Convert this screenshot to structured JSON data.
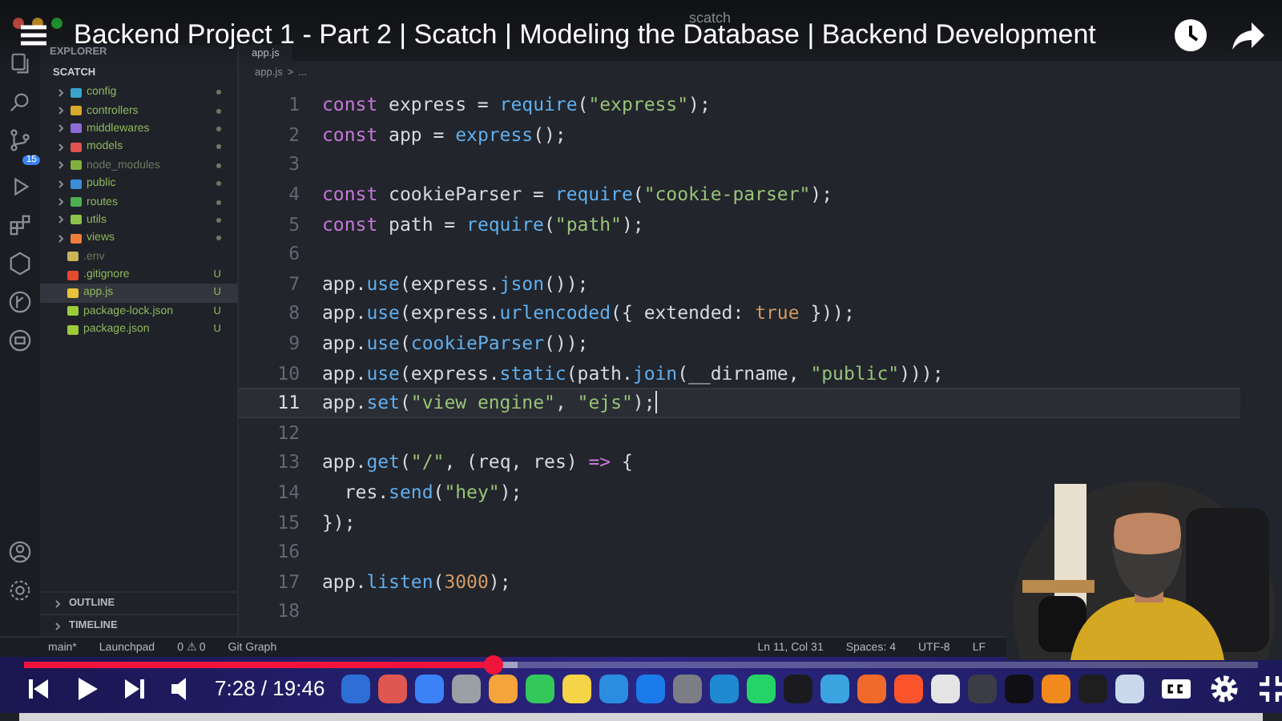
{
  "video": {
    "title": "Backend Project 1 - Part 2 | Scatch | Modeling the Database | Backend Development"
  },
  "editor_window": {
    "title": "scatch",
    "activity_badge": "15",
    "explorer": {
      "header": "EXPLORER",
      "project": "SCATCH",
      "items": [
        {
          "name": "config",
          "kind": "folder",
          "color": "#3aa3c9",
          "ignored": false,
          "selected": false,
          "changed": true
        },
        {
          "name": "controllers",
          "kind": "folder",
          "color": "#d9a92b",
          "ignored": false,
          "selected": false,
          "changed": true
        },
        {
          "name": "middlewares",
          "kind": "folder",
          "color": "#8e6cd6",
          "ignored": false,
          "selected": false,
          "changed": true
        },
        {
          "name": "models",
          "kind": "folder",
          "color": "#e0524f",
          "ignored": false,
          "selected": false,
          "changed": true
        },
        {
          "name": "node_modules",
          "kind": "folder",
          "color": "#7fb13f",
          "ignored": true,
          "selected": false,
          "changed": true
        },
        {
          "name": "public",
          "kind": "folder",
          "color": "#3a8fd6",
          "ignored": false,
          "selected": false,
          "changed": true
        },
        {
          "name": "routes",
          "kind": "folder",
          "color": "#4caf50",
          "ignored": false,
          "selected": false,
          "changed": true
        },
        {
          "name": "utils",
          "kind": "folder",
          "color": "#8bc34a",
          "ignored": false,
          "selected": false,
          "changed": true
        },
        {
          "name": "views",
          "kind": "folder",
          "color": "#f07d3c",
          "ignored": false,
          "selected": false,
          "changed": true
        },
        {
          "name": ".env",
          "kind": "file",
          "color": "#c9b458",
          "ignored": true,
          "selected": false
        },
        {
          "name": ".gitignore",
          "kind": "file",
          "color": "#e64a2e",
          "ignored": false,
          "selected": false,
          "status": "U"
        },
        {
          "name": "app.js",
          "kind": "file",
          "color": "#e8c33a",
          "ignored": false,
          "selected": true,
          "status": "U"
        },
        {
          "name": "package-lock.json",
          "kind": "file",
          "color": "#9ccc3a",
          "ignored": false,
          "selected": false,
          "status": "U"
        },
        {
          "name": "package.json",
          "kind": "file",
          "color": "#9ccc3a",
          "ignored": false,
          "selected": false,
          "status": "U"
        }
      ],
      "sections": [
        "OUTLINE",
        "TIMELINE"
      ]
    },
    "tab": "app.js",
    "breadcrumb": [
      "app.js",
      ">",
      "..."
    ],
    "code": [
      {
        "number": "1",
        "current": false,
        "tokens": [
          {
            "text": "const",
            "kind": "keyword"
          },
          {
            "text": " express = ",
            "kind": "plain"
          },
          {
            "text": "require",
            "kind": "func"
          },
          {
            "text": "(",
            "kind": "plain"
          },
          {
            "text": "\"express\"",
            "kind": "string"
          },
          {
            "text": ");",
            "kind": "plain"
          }
        ]
      },
      {
        "number": "2",
        "current": false,
        "tokens": [
          {
            "text": "const",
            "kind": "keyword"
          },
          {
            "text": " app = ",
            "kind": "plain"
          },
          {
            "text": "express",
            "kind": "func"
          },
          {
            "text": "();",
            "kind": "plain"
          }
        ]
      },
      {
        "number": "3",
        "current": false
      },
      {
        "number": "4",
        "current": false,
        "tokens": [
          {
            "text": "const",
            "kind": "keyword"
          },
          {
            "text": " cookieParser = ",
            "kind": "plain"
          },
          {
            "text": "require",
            "kind": "func"
          },
          {
            "text": "(",
            "kind": "plain"
          },
          {
            "text": "\"cookie-parser\"",
            "kind": "string"
          },
          {
            "text": ");",
            "kind": "plain"
          }
        ]
      },
      {
        "number": "5",
        "current": false,
        "tokens": [
          {
            "text": "const",
            "kind": "keyword"
          },
          {
            "text": " path = ",
            "kind": "plain"
          },
          {
            "text": "require",
            "kind": "func"
          },
          {
            "text": "(",
            "kind": "plain"
          },
          {
            "text": "\"path\"",
            "kind": "string"
          },
          {
            "text": ");",
            "kind": "plain"
          }
        ]
      },
      {
        "number": "6",
        "current": false
      },
      {
        "number": "7",
        "current": false,
        "tokens": [
          {
            "text": "app.",
            "kind": "plain"
          },
          {
            "text": "use",
            "kind": "func"
          },
          {
            "text": "(express.",
            "kind": "plain"
          },
          {
            "text": "json",
            "kind": "func"
          },
          {
            "text": "());",
            "kind": "plain"
          }
        ]
      },
      {
        "number": "8",
        "current": false,
        "tokens": [
          {
            "text": "app.",
            "kind": "plain"
          },
          {
            "text": "use",
            "kind": "func"
          },
          {
            "text": "(express.",
            "kind": "plain"
          },
          {
            "text": "urlencoded",
            "kind": "func"
          },
          {
            "text": "({ extended: ",
            "kind": "plain"
          },
          {
            "text": "true",
            "kind": "number"
          },
          {
            "text": " }));",
            "kind": "plain"
          }
        ]
      },
      {
        "number": "9",
        "current": false,
        "tokens": [
          {
            "text": "app.",
            "kind": "plain"
          },
          {
            "text": "use",
            "kind": "func"
          },
          {
            "text": "(",
            "kind": "plain"
          },
          {
            "text": "cookieParser",
            "kind": "func"
          },
          {
            "text": "());",
            "kind": "plain"
          }
        ]
      },
      {
        "number": "10",
        "current": false,
        "tokens": [
          {
            "text": "app.",
            "kind": "plain"
          },
          {
            "text": "use",
            "kind": "func"
          },
          {
            "text": "(express.",
            "kind": "plain"
          },
          {
            "text": "static",
            "kind": "func"
          },
          {
            "text": "(path.",
            "kind": "plain"
          },
          {
            "text": "join",
            "kind": "func"
          },
          {
            "text": "(__dirname, ",
            "kind": "plain"
          },
          {
            "text": "\"public\"",
            "kind": "string"
          },
          {
            "text": ")));",
            "kind": "plain"
          }
        ]
      },
      {
        "number": "11",
        "current": true,
        "tokens": [
          {
            "text": "app.",
            "kind": "plain"
          },
          {
            "text": "set",
            "kind": "func"
          },
          {
            "text": "(",
            "kind": "plain"
          },
          {
            "text": "\"view engine\"",
            "kind": "string"
          },
          {
            "text": ", ",
            "kind": "plain"
          },
          {
            "text": "\"ejs\"",
            "kind": "string"
          },
          {
            "text": ");",
            "kind": "plain"
          }
        ]
      },
      {
        "number": "12",
        "current": false
      },
      {
        "number": "13",
        "current": false,
        "tokens": [
          {
            "text": "app.",
            "kind": "plain"
          },
          {
            "text": "get",
            "kind": "func"
          },
          {
            "text": "(",
            "kind": "plain"
          },
          {
            "text": "\"/\"",
            "kind": "string"
          },
          {
            "text": ", (req, res) ",
            "kind": "plain"
          },
          {
            "text": "=>",
            "kind": "keyword"
          },
          {
            "text": " {",
            "kind": "plain"
          }
        ]
      },
      {
        "number": "14",
        "current": false,
        "tokens": [
          {
            "text": "  res.",
            "kind": "plain"
          },
          {
            "text": "send",
            "kind": "func"
          },
          {
            "text": "(",
            "kind": "plain"
          },
          {
            "text": "\"hey\"",
            "kind": "string"
          },
          {
            "text": ");",
            "kind": "plain"
          }
        ]
      },
      {
        "number": "15",
        "current": false,
        "tokens": [
          {
            "text": "});",
            "kind": "plain"
          }
        ]
      },
      {
        "number": "16",
        "current": false
      },
      {
        "number": "17",
        "current": false,
        "tokens": [
          {
            "text": "app.",
            "kind": "plain"
          },
          {
            "text": "listen",
            "kind": "func"
          },
          {
            "text": "(",
            "kind": "plain"
          },
          {
            "text": "3000",
            "kind": "number"
          },
          {
            "text": ");",
            "kind": "plain"
          }
        ]
      },
      {
        "number": "18",
        "current": false
      }
    ],
    "status_bar": {
      "left": [
        "main*",
        "Launchpad",
        "0 ⚠ 0",
        "Git Graph"
      ],
      "right": [
        "Ln 11, Col 31",
        "Spaces: 4",
        "UTF-8",
        "LF"
      ]
    }
  },
  "player": {
    "level": 0.38,
    "time": "7:28 / 19:46"
  }
}
